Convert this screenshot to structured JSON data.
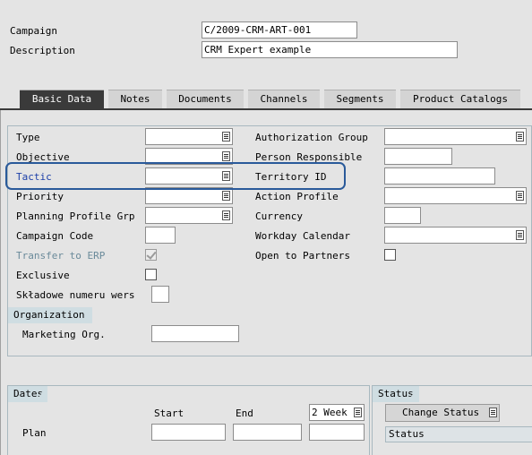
{
  "header": {
    "campaign_label": "Campaign",
    "campaign_value": "C/2009-CRM-ART-001",
    "description_label": "Description",
    "description_value": "CRM Expert example"
  },
  "tabs": [
    {
      "label": "Basic Data",
      "active": true
    },
    {
      "label": "Notes"
    },
    {
      "label": "Documents"
    },
    {
      "label": "Channels"
    },
    {
      "label": "Segments"
    },
    {
      "label": "Product Catalogs"
    }
  ],
  "left_fields": {
    "type": "Type",
    "objective": "Objective",
    "tactic": "Tactic",
    "priority": "Priority",
    "planning_profile_grp": "Planning Profile Grp",
    "campaign_code": "Campaign Code",
    "transfer_to_erp": "Transfer to ERP",
    "exclusive": "Exclusive",
    "skladowe": "Składowe numeru wers"
  },
  "right_fields": {
    "authorization_group": "Authorization Group",
    "person_responsible": "Person Responsible",
    "territory_id": "Territory ID",
    "action_profile": "Action Profile",
    "currency": "Currency",
    "workday_calendar": "Workday Calendar",
    "open_to_partners": "Open to Partners"
  },
  "organization": {
    "title": "Organization",
    "marketing_org": "Marketing Org."
  },
  "dates": {
    "title": "Dates",
    "start": "Start",
    "end": "End",
    "duration_unit": "2 Week",
    "plan": "Plan"
  },
  "status": {
    "title": "Status",
    "change_status": "Change Status",
    "column": "Status"
  },
  "colors": {
    "highlight_border": "#2a5a9a",
    "tactic_text": "#1c3fa8",
    "disabled_text": "#6a8a9a",
    "section_header": "#cfdde2"
  }
}
